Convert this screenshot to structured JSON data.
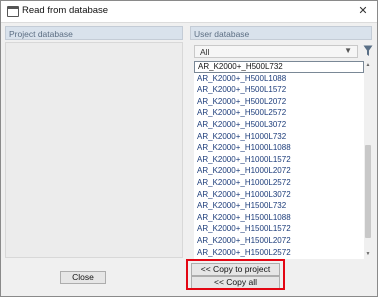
{
  "window": {
    "title": "Read from database",
    "close_glyph": "✕",
    "icon": "window-icon"
  },
  "left_panel": {
    "header": "Project database"
  },
  "right_panel": {
    "header": "User database",
    "filter": {
      "value": "All",
      "dropdown_icon": "chevron-down-icon",
      "filter_icon": "funnel-icon"
    },
    "items": [
      "AR_K2000+_H500L732",
      "AR_K2000+_H500L1088",
      "AR_K2000+_H500L1572",
      "AR_K2000+_H500L2072",
      "AR_K2000+_H500L2572",
      "AR_K2000+_H500L3072",
      "AR_K2000+_H1000L732",
      "AR_K2000+_H1000L1088",
      "AR_K2000+_H1000L1572",
      "AR_K2000+_H1000L2072",
      "AR_K2000+_H1000L2572",
      "AR_K2000+_H1000L3072",
      "AR_K2000+_H1500L732",
      "AR_K2000+_H1500L1088",
      "AR_K2000+_H1500L1572",
      "AR_K2000+_H1500L2072",
      "AR_K2000+_H1500L2572"
    ],
    "selected_index": 0
  },
  "buttons": {
    "close": "Close",
    "copy_to_project": "<< Copy to project",
    "copy_all": "<< Copy all"
  },
  "colors": {
    "highlight": "#e30613",
    "list_text": "#1c3c7a",
    "header_bg": "#d9e2ec"
  }
}
